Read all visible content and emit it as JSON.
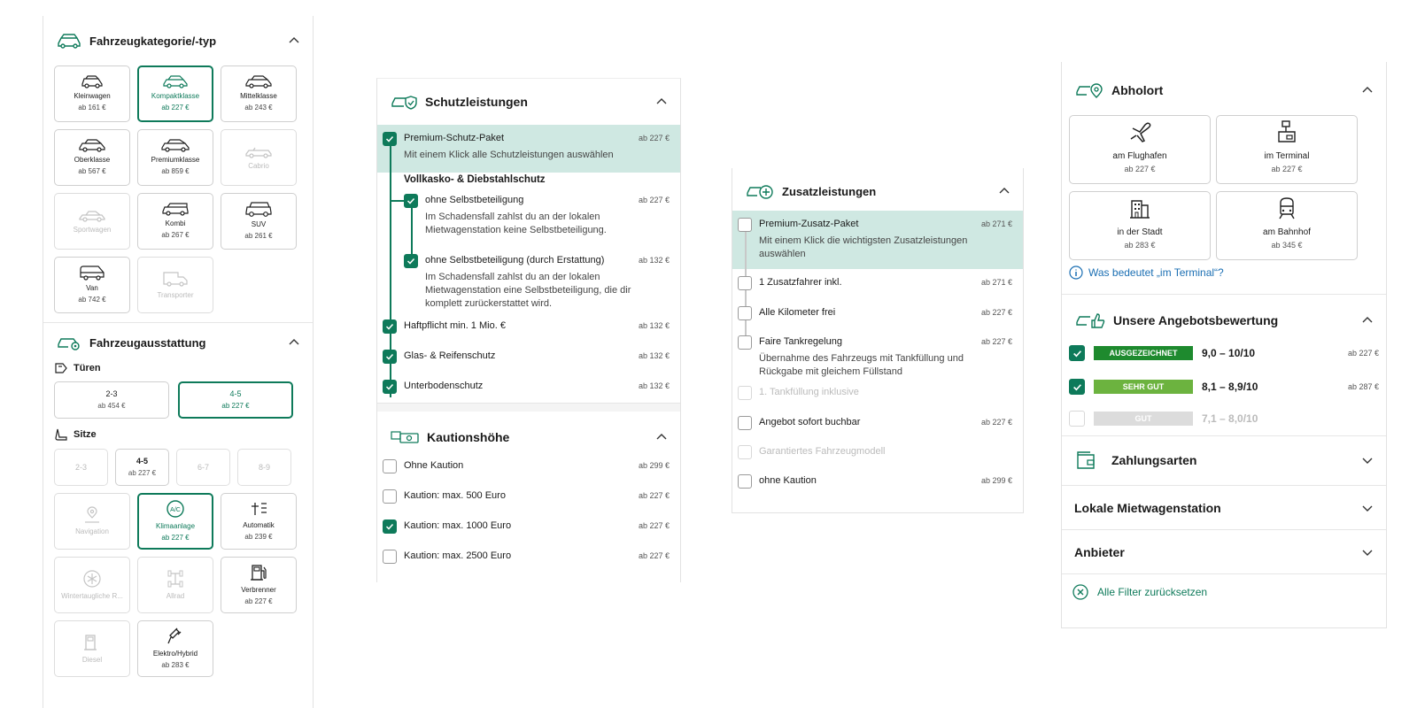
{
  "colors": {
    "accent": "#0e7a5a",
    "highlight": "#cfe8e2",
    "badge_excellent": "#1e8a2e",
    "badge_verygood": "#6cb33f",
    "badge_good": "#dcdcdc"
  },
  "panel1": {
    "category": {
      "title": "Fahrzeugkategorie/-typ",
      "tiles": [
        {
          "name": "Kleinwagen",
          "price": "ab 161 €",
          "state": "normal"
        },
        {
          "name": "Kompaktklasse",
          "price": "ab 227 €",
          "state": "selected"
        },
        {
          "name": "Mittelklasse",
          "price": "ab 243 €",
          "state": "normal"
        },
        {
          "name": "Oberklasse",
          "price": "ab 567 €",
          "state": "normal"
        },
        {
          "name": "Premiumklasse",
          "price": "ab 859 €",
          "state": "normal"
        },
        {
          "name": "Cabrio",
          "price": "",
          "state": "disabled"
        },
        {
          "name": "Sportwagen",
          "price": "",
          "state": "disabled"
        },
        {
          "name": "Kombi",
          "price": "ab 267 €",
          "state": "normal"
        },
        {
          "name": "SUV",
          "price": "ab 261 €",
          "state": "normal"
        },
        {
          "name": "Van",
          "price": "ab 742 €",
          "state": "normal"
        },
        {
          "name": "Transporter",
          "price": "",
          "state": "disabled"
        }
      ]
    },
    "equipment": {
      "title": "Fahrzeugausstattung",
      "doors_label": "Türen",
      "doors": [
        {
          "name": "2-3",
          "price": "ab 454 €",
          "state": "normal"
        },
        {
          "name": "4-5",
          "price": "ab 227 €",
          "state": "selected"
        }
      ],
      "seats_label": "Sitze",
      "seats": [
        {
          "name": "2-3",
          "price": "",
          "state": "disabled"
        },
        {
          "name": "4-5",
          "price": "ab 227 €",
          "state": "normal"
        },
        {
          "name": "6-7",
          "price": "",
          "state": "disabled"
        },
        {
          "name": "8-9",
          "price": "",
          "state": "disabled"
        }
      ],
      "features": [
        {
          "name": "Navigation",
          "price": "",
          "state": "disabled",
          "icon": "map-pin-icon"
        },
        {
          "name": "Klimaanlage",
          "price": "ab 227 €",
          "state": "selected",
          "icon": "ac-icon"
        },
        {
          "name": "Automatik",
          "price": "ab 239 €",
          "state": "normal",
          "icon": "gearshift-icon"
        },
        {
          "name": "Wintertaugliche R...",
          "price": "",
          "state": "disabled",
          "icon": "snowflake-icon"
        },
        {
          "name": "Allrad",
          "price": "",
          "state": "disabled",
          "icon": "axle-icon"
        },
        {
          "name": "Verbrenner",
          "price": "ab 227 €",
          "state": "normal",
          "icon": "fuel-pump-icon"
        },
        {
          "name": "Diesel",
          "price": "",
          "state": "disabled",
          "icon": "fuel-pump-icon"
        },
        {
          "name": "Elektro/Hybrid",
          "price": "ab 283 €",
          "state": "normal",
          "icon": "plug-icon"
        }
      ]
    }
  },
  "panel2": {
    "protection": {
      "title": "Schutzleistungen",
      "package": {
        "label": "Premium-Schutz-Paket",
        "price": "ab 227 €",
        "desc": "Mit einem Klick alle Schutzleistungen auswählen"
      },
      "subheading": "Vollkasko- & Diebstahlschutz",
      "items": [
        {
          "label": "ohne Selbstbeteiligung",
          "price": "ab 227 €",
          "desc1": "Im Schadensfall zahlst du an der lokalen",
          "desc2": "Mietwagenstation keine Selbstbeteiligung."
        },
        {
          "label": "ohne Selbstbeteiligung (durch Erstattung)",
          "price": "ab 132 €",
          "desc1": "Im Schadensfall zahlst du an der lokalen",
          "desc2": "Mietwagenstation eine Selbstbeteiligung, die dir",
          "desc3": "komplett zurückerstattet wird."
        },
        {
          "label": "Haftpflicht min. 1 Mio. €",
          "price": "ab 132 €"
        },
        {
          "label": "Glas- & Reifenschutz",
          "price": "ab 132 €"
        },
        {
          "label": "Unterbodenschutz",
          "price": "ab 132 €"
        }
      ]
    },
    "deposit": {
      "title": "Kautionshöhe",
      "items": [
        {
          "label": "Ohne Kaution",
          "price": "ab 299 €",
          "checked": false
        },
        {
          "label": "Kaution: max. 500 Euro",
          "price": "ab 227 €",
          "checked": false
        },
        {
          "label": "Kaution: max. 1000 Euro",
          "price": "ab 227 €",
          "checked": true
        },
        {
          "label": "Kaution: max. 2500 Euro",
          "price": "ab 227 €",
          "checked": false
        }
      ]
    }
  },
  "panel3": {
    "title": "Zusatzleistungen",
    "package": {
      "label": "Premium-Zusatz-Paket",
      "price": "ab 271 €",
      "desc1": "Mit einem Klick die wichtigsten Zusatzleistungen",
      "desc2": "auswählen"
    },
    "items": [
      {
        "label": "1 Zusatzfahrer inkl.",
        "price": "ab 271 €"
      },
      {
        "label": "Alle Kilometer frei",
        "price": "ab 227 €"
      },
      {
        "label": "Faire Tankregelung",
        "price": "ab 227 €",
        "desc1": "Übernahme des Fahrzeugs mit Tankfüllung und",
        "desc2": "Rückgabe mit gleichem Füllstand"
      },
      {
        "label": "1. Tankfüllung inklusive",
        "price": ""
      },
      {
        "label": "Angebot sofort buchbar",
        "price": "ab 227 €"
      },
      {
        "label": "Garantiertes Fahrzeugmodell",
        "price": ""
      },
      {
        "label": "ohne Kaution",
        "price": "ab 299 €"
      }
    ]
  },
  "panel4": {
    "pickup": {
      "title": "Abholort",
      "locations": [
        {
          "name": "am Flughafen",
          "price": "ab 227 €",
          "icon": "airplane-icon"
        },
        {
          "name": "im Terminal",
          "price": "ab 227 €",
          "icon": "terminal-icon"
        },
        {
          "name": "in der Stadt",
          "price": "ab 283 €",
          "icon": "building-icon"
        },
        {
          "name": "am Bahnhof",
          "price": "ab 345 €",
          "icon": "train-icon"
        }
      ],
      "info_link": "Was bedeutet „im Terminal“?"
    },
    "rating": {
      "title": "Unsere Angebotsbewertung",
      "items": [
        {
          "badge": "AUSGEZEICHNET",
          "range": "9,0 – 10/10",
          "price": "ab 227 €"
        },
        {
          "badge": "SEHR GUT",
          "range": "8,1 – 8,9/10",
          "price": "ab 287 €"
        },
        {
          "badge": "GUT",
          "range": "7,1 – 8,0/10",
          "price": ""
        }
      ]
    },
    "payment_title": "Zahlungsarten",
    "station_title": "Lokale Mietwagenstation",
    "provider_title": "Anbieter",
    "reset_label": "Alle Filter zurücksetzen"
  }
}
